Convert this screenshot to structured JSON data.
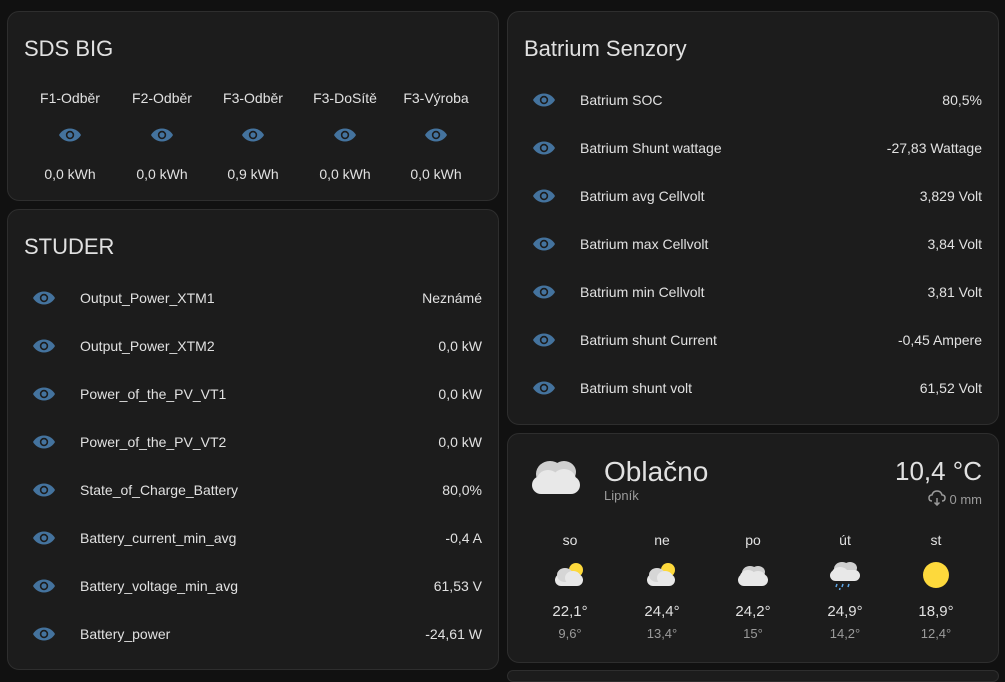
{
  "sds_big": {
    "title": "SDS BIG",
    "columns": [
      {
        "label": "F1-Odběr",
        "value": "0,0 kWh"
      },
      {
        "label": "F2-Odběr",
        "value": "0,0 kWh"
      },
      {
        "label": "F3-Odběr",
        "value": "0,9 kWh"
      },
      {
        "label": "F3-DoSítě",
        "value": "0,0 kWh"
      },
      {
        "label": "F3-Výroba",
        "value": "0,0 kWh"
      }
    ]
  },
  "studer": {
    "title": "STUDER",
    "rows": [
      {
        "name": "Output_Power_XTM1",
        "value": "Neznámé"
      },
      {
        "name": "Output_Power_XTM2",
        "value": "0,0 kW"
      },
      {
        "name": "Power_of_the_PV_VT1",
        "value": "0,0 kW"
      },
      {
        "name": "Power_of_the_PV_VT2",
        "value": "0,0 kW"
      },
      {
        "name": "State_of_Charge_Battery",
        "value": "80,0%"
      },
      {
        "name": "Battery_current_min_avg",
        "value": "-0,4 A"
      },
      {
        "name": "Battery_voltage_min_avg",
        "value": "61,53 V"
      },
      {
        "name": "Battery_power",
        "value": "-24,61 W"
      }
    ]
  },
  "batrium": {
    "title": "Batrium Senzory",
    "rows": [
      {
        "name": "Batrium SOC",
        "value": "80,5%"
      },
      {
        "name": "Batrium Shunt wattage",
        "value": "-27,83 Wattage"
      },
      {
        "name": "Batrium avg Cellvolt",
        "value": "3,829 Volt"
      },
      {
        "name": "Batrium max Cellvolt",
        "value": "3,84 Volt"
      },
      {
        "name": "Batrium min Cellvolt",
        "value": "3,81 Volt"
      },
      {
        "name": "Batrium shunt Current",
        "value": "-0,45 Ampere"
      },
      {
        "name": "Batrium shunt volt",
        "value": "61,52 Volt"
      }
    ]
  },
  "weather": {
    "condition": "Oblačno",
    "location": "Lipník",
    "temperature": "10,4 °C",
    "precipitation": "0 mm",
    "current_icon": "cloudy-icon",
    "forecast": [
      {
        "day": "so",
        "icon": "partly-cloudy-icon",
        "high": "22,1°",
        "low": "9,6°"
      },
      {
        "day": "ne",
        "icon": "partly-cloudy-icon",
        "high": "24,4°",
        "low": "13,4°"
      },
      {
        "day": "po",
        "icon": "cloudy-icon",
        "high": "24,2°",
        "low": "15°"
      },
      {
        "day": "út",
        "icon": "rainy-icon",
        "high": "24,9°",
        "low": "14,2°"
      },
      {
        "day": "st",
        "icon": "sunny-icon",
        "high": "18,9°",
        "low": "12,4°"
      }
    ]
  },
  "colors": {
    "background": "#111111",
    "card": "#1c1c1c",
    "eye_icon": "#44739e",
    "sun": "#fdd93c",
    "cloud": "#e8e8e8"
  }
}
